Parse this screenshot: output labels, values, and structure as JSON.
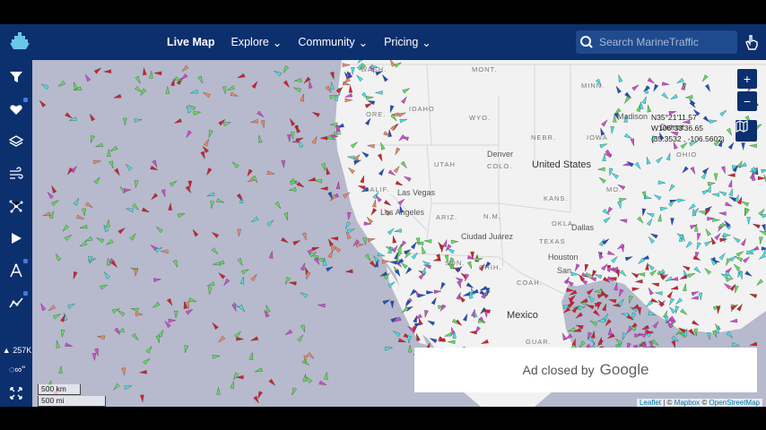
{
  "nav": {
    "items": [
      {
        "label": "Live Map",
        "active": true
      },
      {
        "label": "Explore",
        "dropdown": true
      },
      {
        "label": "Community",
        "dropdown": true
      },
      {
        "label": "Pricing",
        "dropdown": true
      }
    ],
    "search_placeholder": "Search MarineTraffic"
  },
  "sidebar": {
    "buttons": [
      "filter-icon",
      "heart-icon",
      "layers-icon",
      "wind-icon",
      "network-icon",
      "play-icon",
      "measure-icon",
      "analytics-icon"
    ],
    "vessel_count": "257K",
    "time_label": "∞\""
  },
  "map": {
    "coordinates": {
      "lat": "N35°21'11.57",
      "lon": "W106°33'36.65",
      "decimal": "(35.3532 , -106.5602)"
    },
    "labels": {
      "wash": "WASH.",
      "mont": "MONT.",
      "ore": "ORE.",
      "idaho": "IDAHO",
      "wyo": "WYO.",
      "minn": "MINN.",
      "nebr": "NEBR.",
      "denver": "Denver",
      "utah": "UTAH",
      "colo": "COLO.",
      "iowa": "IOWA",
      "madison": "Madison",
      "detroit": "Detroit",
      "us": "United States",
      "ohio": "OHIO",
      "calif": "CALIF.",
      "las_vegas": "Las Vegas",
      "kans": "KANS.",
      "mo": "MO.",
      "los_angeles": "Los Angeles",
      "ariz": "ARIZ.",
      "nm": "N.M.",
      "okla": "OKLA.",
      "dallas": "Dallas",
      "ciudad_juarez": "Ciudad Juárez",
      "texas": "TEXAS",
      "son": "SON.",
      "chih": "CHIH.",
      "houston": "Houston",
      "san": "San",
      "coah": "COAH.",
      "mexico": "Mexico",
      "guar": "GUAR."
    },
    "ad_text": "Ad closed by",
    "ad_brand": "Google",
    "scale_km": "500 km",
    "scale_mi": "500 mi",
    "attribution": {
      "leaflet": "Leaflet",
      "sep": "| ©",
      "mapbox": "Mapbox",
      "osm_prefix": "©",
      "osm": "OpenStreetMap"
    }
  },
  "colors": {
    "navbar": "#0c2f6e",
    "ocean": "#b7b9cc",
    "land": "#f2f2f2",
    "cargo": "#5ee05a",
    "tanker": "#d8202a",
    "passenger": "#1f4fc8",
    "tug": "#44e3e6",
    "pleasure": "#d54ad6",
    "fishing": "#f08a60"
  }
}
